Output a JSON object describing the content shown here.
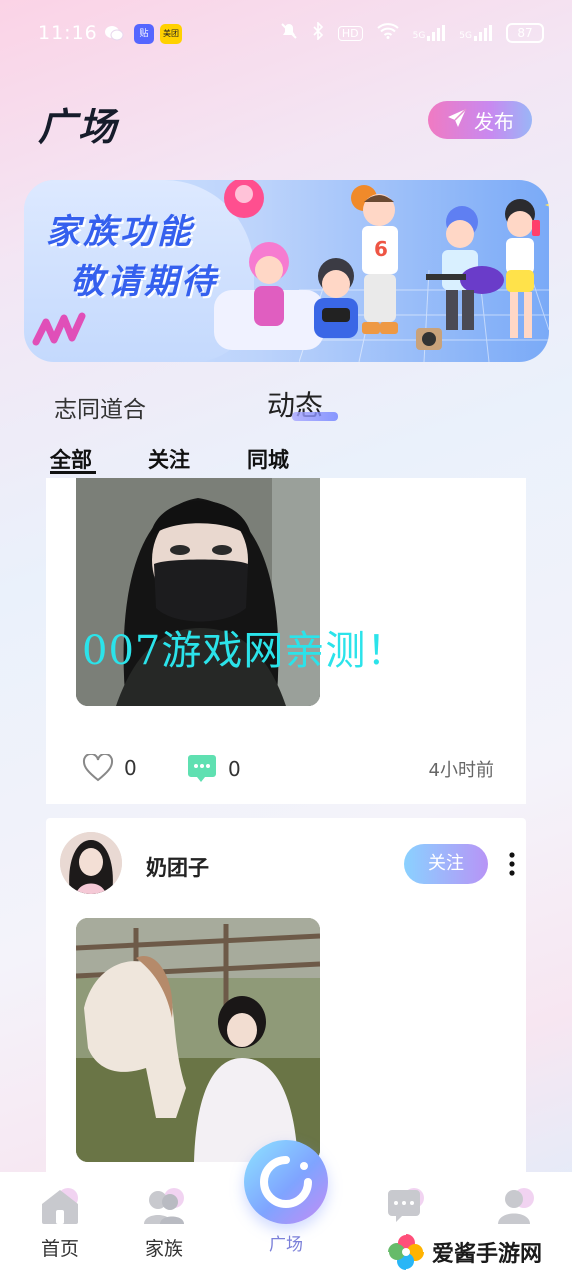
{
  "status_bar": {
    "time": "11:16",
    "apps": [
      "贴",
      "美团"
    ],
    "hd_badge": "HD",
    "network": [
      "5G",
      "5G"
    ],
    "battery": "87"
  },
  "header": {
    "title": "广场",
    "publish_label": "发布"
  },
  "banner": {
    "line1": "家族功能",
    "line2": "敬请期待"
  },
  "main_tabs": [
    {
      "label": "志同道合",
      "active": false
    },
    {
      "label": "动态",
      "active": true
    }
  ],
  "sub_tabs": [
    {
      "label": "全部",
      "active": true
    },
    {
      "label": "关注",
      "active": false
    },
    {
      "label": "同城",
      "active": false
    }
  ],
  "posts": [
    {
      "watermark": "007游戏网亲测！",
      "likes": "0",
      "comments": "0",
      "time_ago": "4小时前"
    },
    {
      "username": "奶团子",
      "follow_label": "关注"
    }
  ],
  "bottom_nav": [
    {
      "label": "首页",
      "icon": "home-icon"
    },
    {
      "label": "家族",
      "icon": "family-icon"
    },
    {
      "label": "广场",
      "icon": "plaza-icon",
      "active": true
    },
    {
      "label": "",
      "icon": "message-icon"
    },
    {
      "label": "",
      "icon": "profile-icon"
    }
  ],
  "watermark_site": "爱酱手游网",
  "colors": {
    "accent_purple": "#7a7fd9",
    "banner_text": "#3560ee",
    "watermark": "#2be3ea"
  }
}
